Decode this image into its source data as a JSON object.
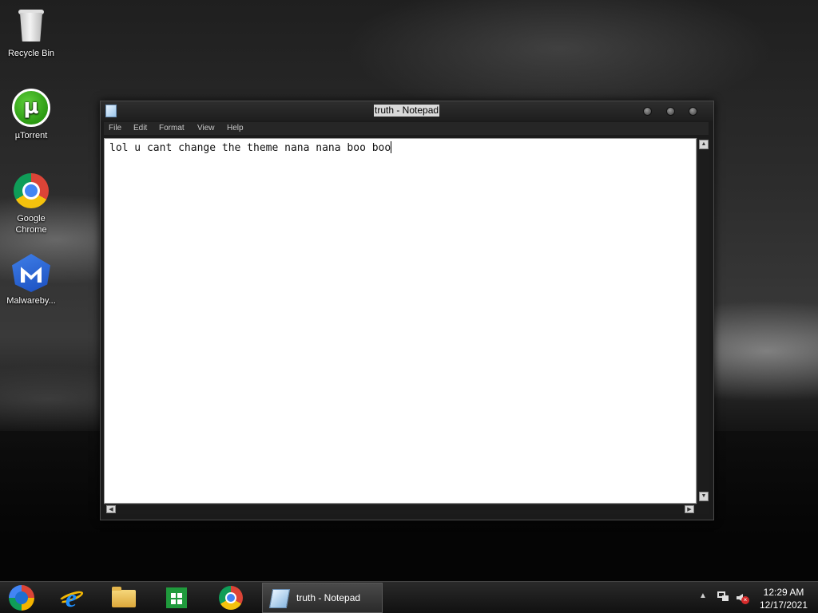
{
  "desktop": {
    "icons": [
      {
        "label": "Recycle Bin",
        "icon": "recycle-bin-icon"
      },
      {
        "label": "µTorrent",
        "icon": "utorrent-icon",
        "glyph": "µ"
      },
      {
        "label": "Google Chrome",
        "icon": "chrome-icon"
      },
      {
        "label": "Malwareby...",
        "icon": "malwarebytes-icon"
      }
    ]
  },
  "notepad": {
    "title": "truth - Notepad",
    "menu": [
      "File",
      "Edit",
      "Format",
      "View",
      "Help"
    ],
    "content": "lol u cant change the theme nana nana boo boo",
    "scroll_up": "▲",
    "scroll_down": "▼",
    "scroll_left": "◀",
    "scroll_right": "▶"
  },
  "taskbar": {
    "pinned": [
      "start-orb",
      "internet-explorer-icon",
      "file-explorer-icon",
      "store-icon",
      "chrome-icon"
    ],
    "active_task": "truth - Notepad",
    "tray_arrow": "▲",
    "volume_mute_glyph": "×",
    "time": "12:29 AM",
    "date": "12/17/2021"
  },
  "colors": {
    "title_highlight": "#d9d9d9",
    "window_bg": "#1b1b1b",
    "editor_bg": "#ffffff"
  }
}
